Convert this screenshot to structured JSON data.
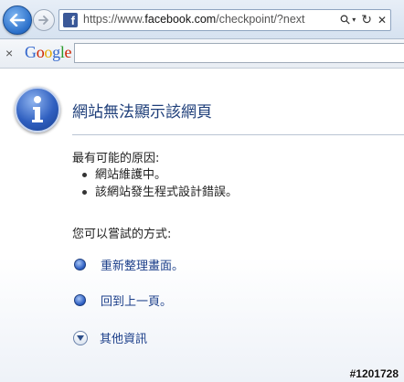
{
  "browser": {
    "url_prefix": "https://www.",
    "url_domain": "facebook.com",
    "url_path": "/checkpoint/?next",
    "favicon_letter": "f",
    "tools": {
      "search_glyph": "⚲",
      "dropdown_glyph": "▾",
      "refresh_glyph": "↻",
      "stop_glyph": "✕"
    }
  },
  "google_bar": {
    "close_glyph": "×",
    "logo": [
      "G",
      "o",
      "o",
      "g",
      "l",
      "e"
    ],
    "search_value": ""
  },
  "error_page": {
    "title": "網站無法顯示該網頁",
    "causes_label": "最有可能的原因:",
    "causes": [
      "網站維護中。",
      "該網站發生程式設計錯誤。"
    ],
    "try_label": "您可以嘗試的方式:",
    "actions": [
      {
        "label": "重新整理畫面。"
      },
      {
        "label": "回到上一頁。"
      }
    ],
    "more_info_label": "其他資訊"
  },
  "watermark": "#1201728",
  "colors": {
    "title": "#1f3f7a",
    "link": "#1c3f8a",
    "facebook": "#3b5998"
  }
}
